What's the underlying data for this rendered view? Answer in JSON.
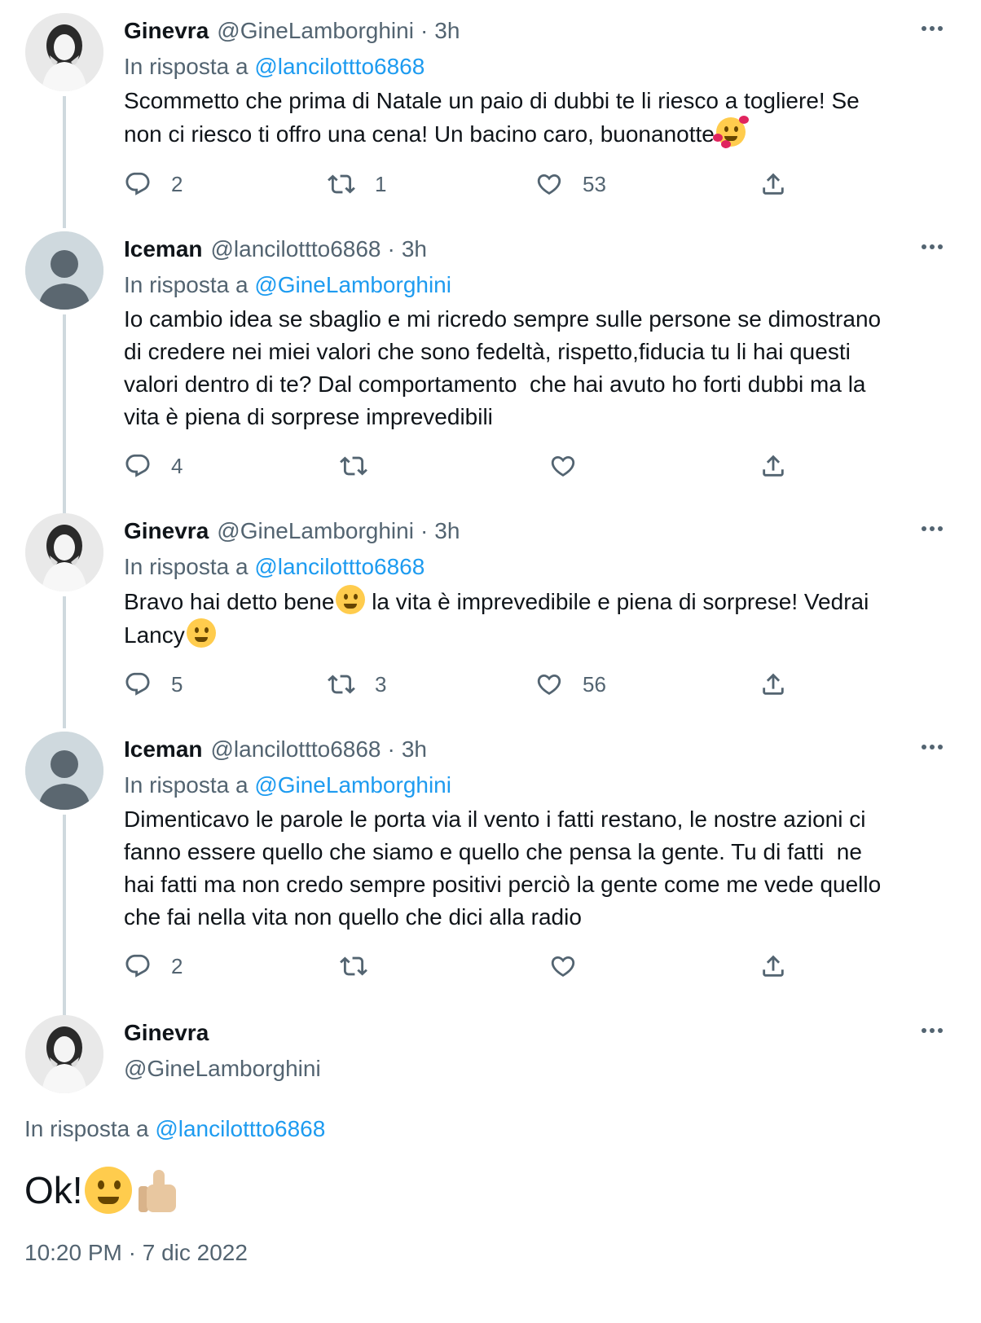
{
  "tweets": [
    {
      "name": "Ginevra",
      "handle": "@GineLamborghini",
      "time": "3h",
      "reply_prefix": "In risposta a",
      "reply_to": "@lancilottto6868",
      "text": "Scommetto che prima di Natale un paio di dubbi te li riesco a togliere! Se\nnon ci riesco ti offro una cena! Un bacino caro, buonanotte",
      "emoji": "smiling-face-with-hearts",
      "replies": "2",
      "retweets": "1",
      "likes": "53"
    },
    {
      "name": "Iceman",
      "handle": "@lancilottto6868",
      "time": "3h",
      "reply_prefix": "In risposta a",
      "reply_to": "@GineLamborghini",
      "text": "Io cambio idea se sbaglio e mi ricredo sempre sulle persone se dimostrano\ndi credere nei miei valori che sono fedeltà, rispetto,fiducia tu li hai questi\nvalori dentro di te? Dal comportamento  che hai avuto ho forti dubbi ma la\nvita è piena di sorprese imprevedibili",
      "replies": "4",
      "retweets": "",
      "likes": ""
    },
    {
      "name": "Ginevra",
      "handle": "@GineLamborghini",
      "time": "3h",
      "reply_prefix": "In risposta a",
      "reply_to": "@lancilottto6868",
      "text_a": "Bravo hai detto bene",
      "text_b": " la vita è imprevedibile e piena di sorprese! Vedrai",
      "text_c": "Lancy",
      "replies": "5",
      "retweets": "3",
      "likes": "56"
    },
    {
      "name": "Iceman",
      "handle": "@lancilottto6868",
      "time": "3h",
      "reply_prefix": "In risposta a",
      "reply_to": "@GineLamborghini",
      "text": "Dimenticavo le parole le porta via il vento i fatti restano, le nostre azioni ci\nfanno essere quello che siamo e quello che pensa la gente. Tu di fatti  ne\nhai fatti ma non credo sempre positivi perciò la gente come me vede quello\nche fai nella vita non quello che dici alla radio",
      "replies": "2",
      "retweets": "",
      "likes": ""
    }
  ],
  "main": {
    "name": "Ginevra",
    "handle": "@GineLamborghini",
    "reply_prefix": "In risposta a",
    "reply_to": "@lancilottto6868",
    "text": "Ok!",
    "emojis": [
      "winking-face",
      "thumbs-up"
    ],
    "timestamp": "10:20 PM · 7 dic 2022"
  },
  "colors": {
    "link": "#1d9bf0",
    "secondary_text": "#536471",
    "primary_text": "#0f1419",
    "thread_line": "#cfd9de"
  }
}
